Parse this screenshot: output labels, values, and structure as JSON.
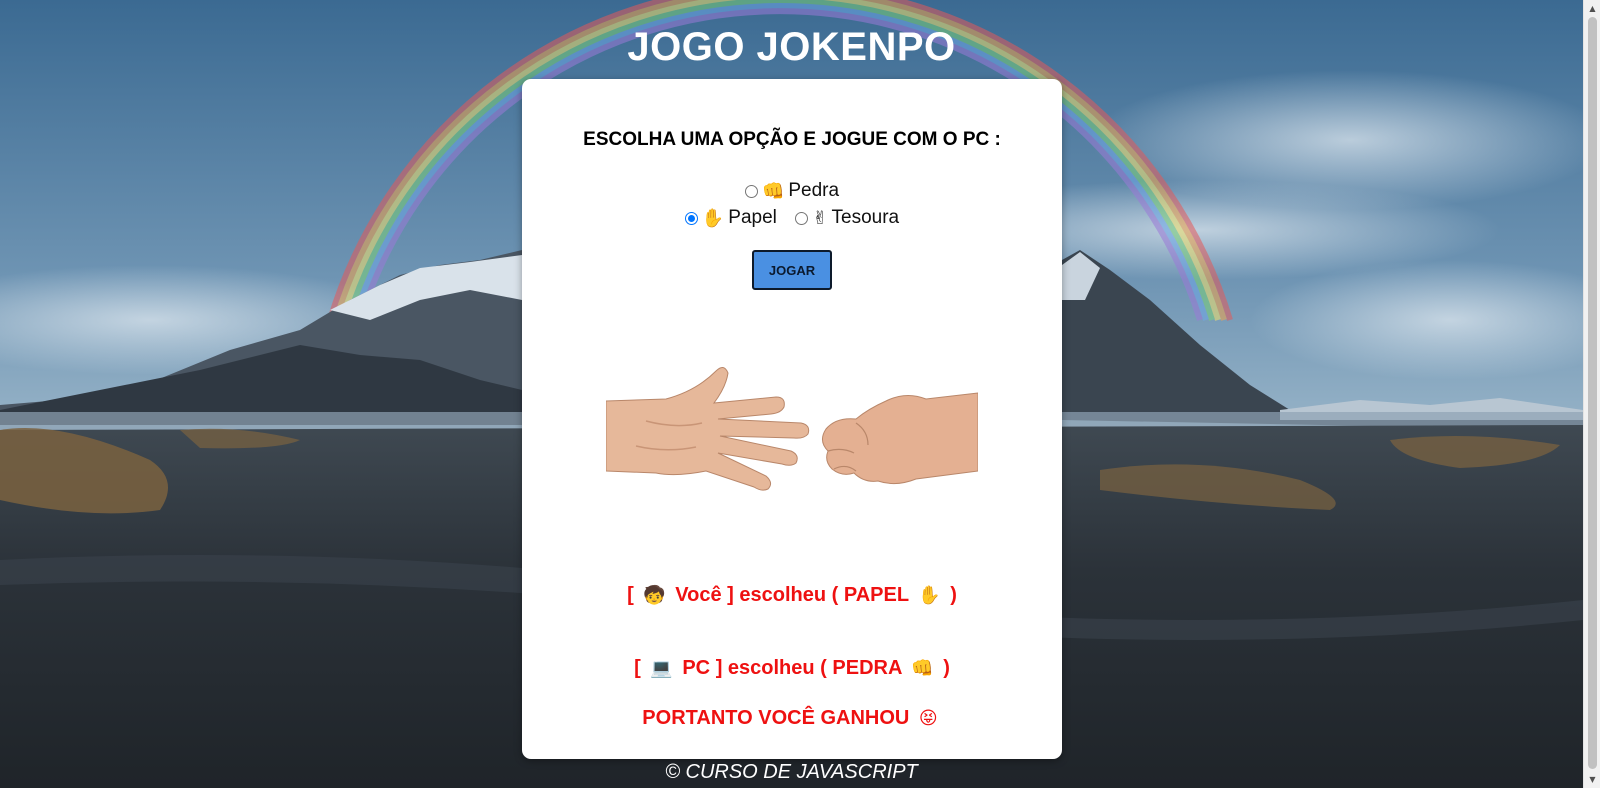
{
  "page": {
    "title": "JOGO JOKENPO",
    "footer": "© CURSO DE JAVASCRIPT"
  },
  "game": {
    "question": "ESCOLHA UMA OPÇÃO E JOGUE COM O PC :",
    "options": [
      {
        "icon": "👊",
        "label": "Pedra",
        "selected": false
      },
      {
        "icon": "✋",
        "label": "Papel",
        "selected": true
      },
      {
        "icon": "✌",
        "label": "Tesoura",
        "selected": false
      }
    ],
    "play_label": "JOGAR",
    "image_name": "rock-paper-hands-image"
  },
  "results": {
    "you": {
      "prefix": "[",
      "icon": "🧒",
      "name": "Você",
      "text": "] escolheu (",
      "choice": "PAPEL",
      "choice_icon": "✋",
      "suffix": ")"
    },
    "pc": {
      "prefix": "[",
      "icon": "💻",
      "name": "PC",
      "text": "] escolheu (",
      "choice": "PEDRA",
      "choice_icon": "👊",
      "suffix": ")"
    },
    "final": {
      "text": "PORTANTO VOCÊ GANHOU",
      "icon": "😝"
    }
  },
  "colors": {
    "result_red": "#ee1111",
    "button_blue": "#4a90e2",
    "radio_blue": "#0075ff"
  }
}
